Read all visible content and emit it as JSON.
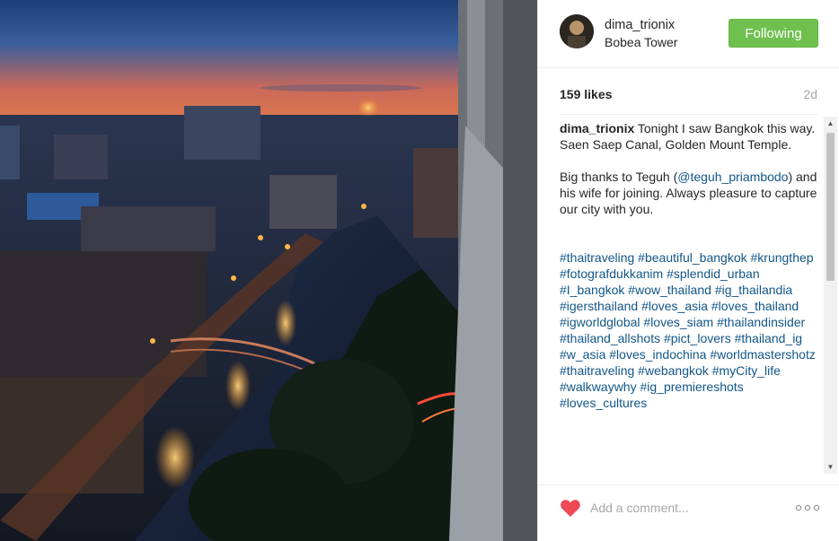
{
  "post": {
    "username": "dima_trionix",
    "location": "Bobea Tower",
    "follow_label": "Following",
    "likes": "159 likes",
    "age": "2d"
  },
  "caption": {
    "username": "dima_trionix",
    "line1": " Tonight I saw Bangkok this way.",
    "line2": "Saen Saep Canal, Golden Mount Temple.",
    "thanks_prefix": "Big thanks to Teguh (",
    "mention": "@teguh_priambodo",
    "thanks_suffix": ") and his wife for joining. Always pleasure to capture our city with you."
  },
  "hashtags": [
    "#thaitraveling",
    "#beautiful_bangkok",
    "#krungthep",
    "#fotografdukkanim",
    "#splendid_urban",
    "#I_bangkok",
    "#wow_thailand",
    "#ig_thailandia",
    "#igersthailand",
    "#loves_asia",
    "#loves_thailand",
    "#igworldglobal",
    "#loves_siam",
    "#thailandinsider",
    "#thailand_allshots",
    "#pict_lovers",
    "#thailand_ig",
    "#w_asia",
    "#loves_indochina",
    "#worldmastershotz",
    "#thaitraveling",
    "#webangkok",
    "#myCity_life",
    "#walkwaywhy",
    "#ig_premiereshots",
    "#loves_cultures"
  ],
  "footer": {
    "comment_placeholder": "Add a comment..."
  },
  "colors": {
    "follow_green": "#70c050",
    "heart_red": "#ed4956",
    "link_blue": "#125688"
  },
  "icons": {
    "like": "heart-icon",
    "more": "more-options-icon"
  }
}
